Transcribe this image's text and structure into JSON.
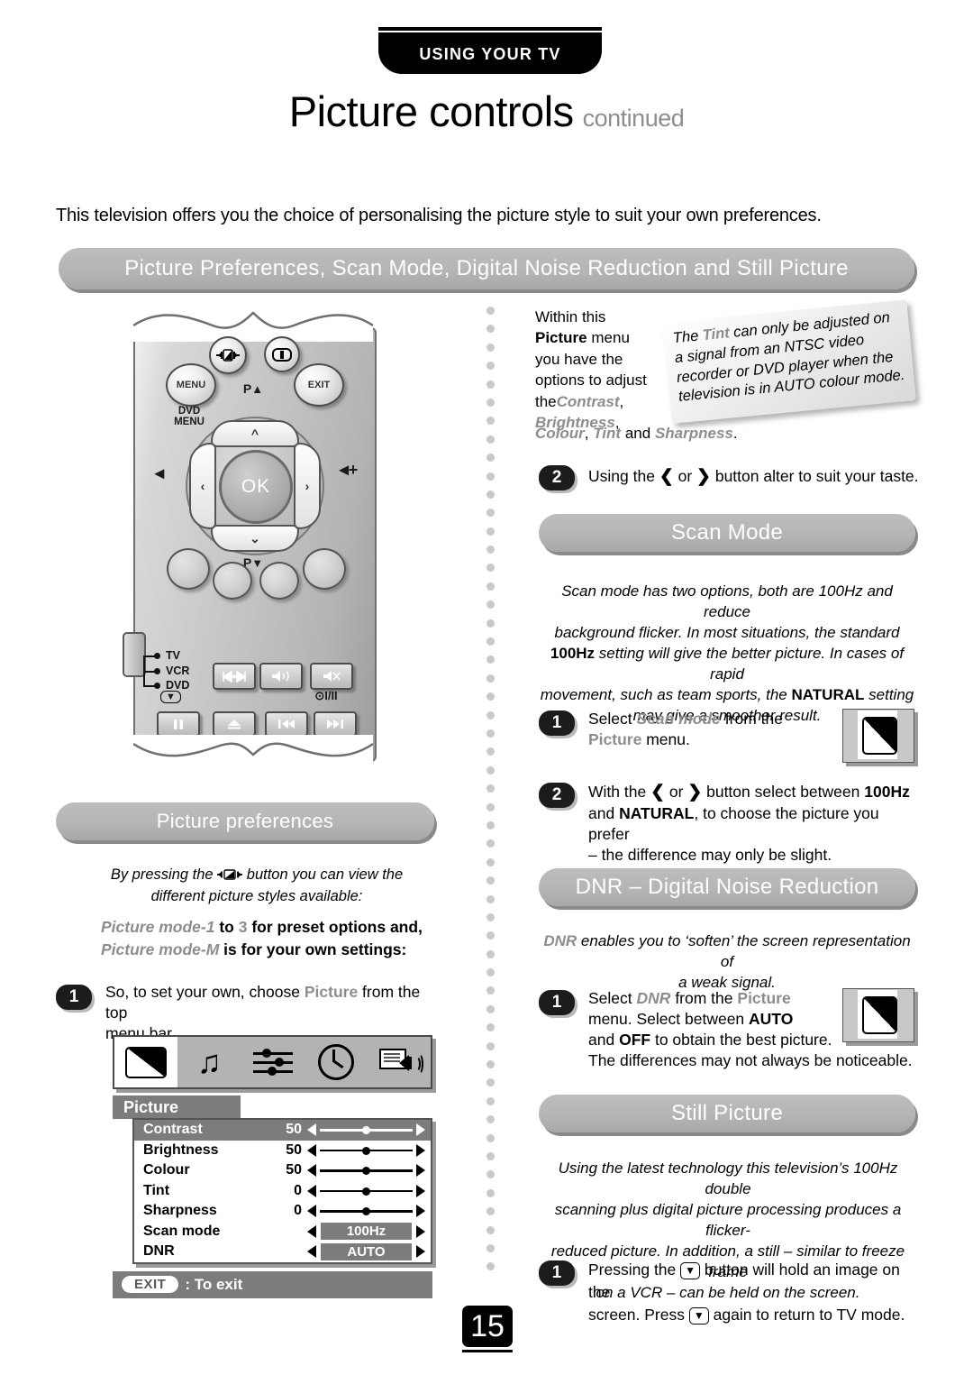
{
  "header": {
    "section_tab": "USING YOUR TV",
    "title": "Picture controls",
    "title_suffix": "continued"
  },
  "intro": "This television offers you the choice of personalising the picture style to suit your own preferences.",
  "pills": {
    "main": "Picture Preferences, Scan Mode, Digital Noise Reduction and Still Picture",
    "picture_preferences": "Picture preferences",
    "scan_mode": "Scan Mode",
    "dnr": "DNR – Digital Noise Reduction",
    "still_picture": "Still Picture"
  },
  "remote": {
    "menu_button": "MENU",
    "dvd_menu_label_1": "DVD",
    "dvd_menu_label_2": "MENU",
    "exit_button": "EXIT",
    "program_up": "P",
    "program_down": "P",
    "ok_button": "OK",
    "mode_tv": "TV",
    "mode_vcr": "VCR",
    "mode_dvd": "DVD",
    "audio_label": "⊙I/II"
  },
  "left_column": {
    "prefs_note_line1": "By pressing the",
    "prefs_note_line1b": "button you can view the",
    "prefs_note_line2": "different picture styles available:",
    "mode_line1_a": "Picture mode-1",
    "mode_line1_b": "to",
    "mode_line1_c": "3",
    "mode_line1_d": "for preset options and,",
    "mode_line2_a": "Picture mode-M",
    "mode_line2_b": "is for your own settings:",
    "step1_number": "1",
    "step1_a": "So, to set your own, choose",
    "step1_b": "Picture",
    "step1_c": "from the top",
    "step1_d": "menu bar."
  },
  "osd": {
    "icons": [
      "picture-icon",
      "sound-icon",
      "feature-icon",
      "clock-icon",
      "subtitle-icon"
    ],
    "title": "Picture",
    "rows": [
      {
        "label": "Contrast",
        "value": "50",
        "type": "slider",
        "highlight": true
      },
      {
        "label": "Brightness",
        "value": "50",
        "type": "slider",
        "highlight": false
      },
      {
        "label": "Colour",
        "value": "50",
        "type": "slider",
        "highlight": false
      },
      {
        "label": "Tint",
        "value": "0",
        "type": "slider",
        "highlight": false
      },
      {
        "label": "Sharpness",
        "value": "0",
        "type": "slider",
        "highlight": false
      },
      {
        "label": "Scan mode",
        "value": "",
        "type": "option",
        "option": "100Hz",
        "highlight": false
      },
      {
        "label": "DNR",
        "value": "",
        "type": "option",
        "option": "AUTO",
        "highlight": false
      }
    ],
    "exit_button": "EXIT",
    "exit_label": ": To exit"
  },
  "right_column": {
    "within_lines": [
      "Within this",
      "Picture",
      "menu",
      "you have the",
      "options to adjust",
      "the",
      "Contrast",
      ",",
      "Brightness",
      ",",
      "Colour",
      ",",
      "Tint",
      "and",
      "Sharpness",
      "."
    ],
    "within_l1": "Within this",
    "within_l2a": "Picture",
    "within_l2b": "menu",
    "within_l3": "you have the",
    "within_l4": "options to adjust",
    "within_l5a": "the",
    "within_l5b": "Contrast",
    "within_l6": "Brightness",
    "within_l7a": "Colour",
    "within_l7b": "Tint",
    "within_l7c": "and",
    "within_l7d": "Sharpness",
    "tint_note": "The Tint can only be adjusted on a signal from an NTSC video recorder or DVD player when the television is in AUTO colour mode.",
    "tint_note_l1a": "The",
    "tint_note_l1b": "Tint",
    "tint_note_l1c": "can only be adjusted on",
    "tint_note_l2": "a signal from an NTSC video",
    "tint_note_l3": "recorder or DVD player when the",
    "tint_note_l4": "television is in AUTO colour mode.",
    "step2_top_number": "2",
    "step2_top_a": "Using the",
    "step2_top_b": "or",
    "step2_top_c": "button alter to suit your taste.",
    "scan_body_l1": "Scan mode has two options, both are 100Hz and reduce",
    "scan_body_l2": "background flicker. In most situations, the standard",
    "scan_body_l3a": "100Hz",
    "scan_body_l3b": "setting will give the better picture. In cases of rapid",
    "scan_body_l4a": "movement, such as team sports, the",
    "scan_body_l4b": "NATURAL",
    "scan_body_l4c": "setting",
    "scan_body_l5": "may give a smoother result.",
    "scan_step1_number": "1",
    "scan_step1_a": "Select",
    "scan_step1_b": "Scan mode",
    "scan_step1_c": "from the",
    "scan_step1_d": "Picture",
    "scan_step1_e": "menu.",
    "scan_step2_number": "2",
    "scan_step2_a": "With the",
    "scan_step2_b": "or",
    "scan_step2_c": "button select between",
    "scan_step2_d": "100Hz",
    "scan_step2_e": "and",
    "scan_step2_f": "NATURAL",
    "scan_step2_g": ", to choose the picture you prefer",
    "scan_step2_h": "– the difference may only be slight.",
    "dnr_body_l1a": "DNR",
    "dnr_body_l1b": "enables you to ‘soften’  the screen representation of",
    "dnr_body_l2": "a weak signal.",
    "dnr_step1_number": "1",
    "dnr_step1_a": "Select",
    "dnr_step1_b": "DNR",
    "dnr_step1_c": "from the",
    "dnr_step1_d": "Picture",
    "dnr_step1_e": "menu. Select between",
    "dnr_step1_f": "AUTO",
    "dnr_step1_g": "and",
    "dnr_step1_h": "OFF",
    "dnr_step1_i": "to obtain the best picture.",
    "dnr_step1_j": "The differences may not always be noticeable.",
    "still_body_l1": "Using the latest technology this television’s 100Hz double",
    "still_body_l2": "scanning plus digital picture processing produces a flicker-",
    "still_body_l3": "reduced picture. In addition, a still – similar to freeze frame",
    "still_body_l4": "on a VCR – can be held on the screen.",
    "still_step1_number": "1",
    "still_step1_a": "Pressing the",
    "still_step1_b": "button will hold an image on the",
    "still_step1_c": "screen. Press",
    "still_step1_d": "again to return to TV mode."
  },
  "page_number": "15",
  "colors": {
    "pill": "#b5b5b5",
    "osd_grey": "#7c7c7c",
    "grey_text": "#8d8d8d",
    "black": "#000000"
  }
}
